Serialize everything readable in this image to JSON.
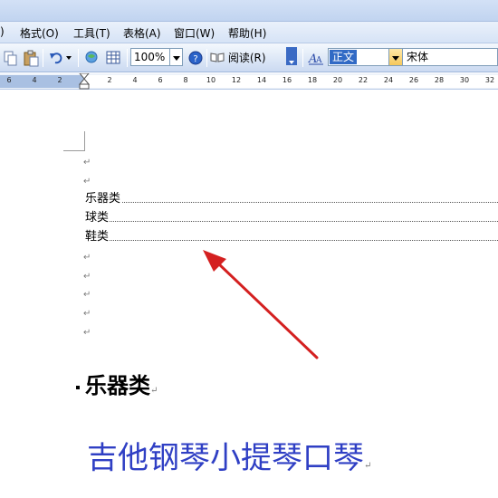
{
  "menubar": {
    "items": [
      {
        "label": "格式(O)"
      },
      {
        "label": "工具(T)"
      },
      {
        "label": "表格(A)"
      },
      {
        "label": "窗口(W)"
      },
      {
        "label": "帮助(H)"
      }
    ],
    "left_fragment": ")"
  },
  "toolbar": {
    "zoom_value": "100%",
    "read_label": "阅读(R)",
    "style_value": "正文",
    "font_value": "宋体",
    "icons": [
      "copy-icon",
      "paste-icon",
      "undo-icon",
      "web-icon",
      "table-icon",
      "help-icon",
      "read-icon",
      "styles-icon"
    ]
  },
  "ruler": {
    "ticks": [
      "6",
      "4",
      "2",
      "2",
      "4",
      "6",
      "8",
      "10",
      "12",
      "14",
      "16",
      "18",
      "20",
      "22",
      "24",
      "26",
      "28",
      "30",
      "32"
    ]
  },
  "document": {
    "paragraph_mark": "↵",
    "toc": [
      "乐器类",
      "球类",
      "鞋类"
    ],
    "heading": "乐器类",
    "body_text": "吉他钢琴小提琴口琴"
  },
  "colors": {
    "accent": "#316ac5",
    "body_text": "#2f3fc4",
    "arrow": "#d42020"
  }
}
